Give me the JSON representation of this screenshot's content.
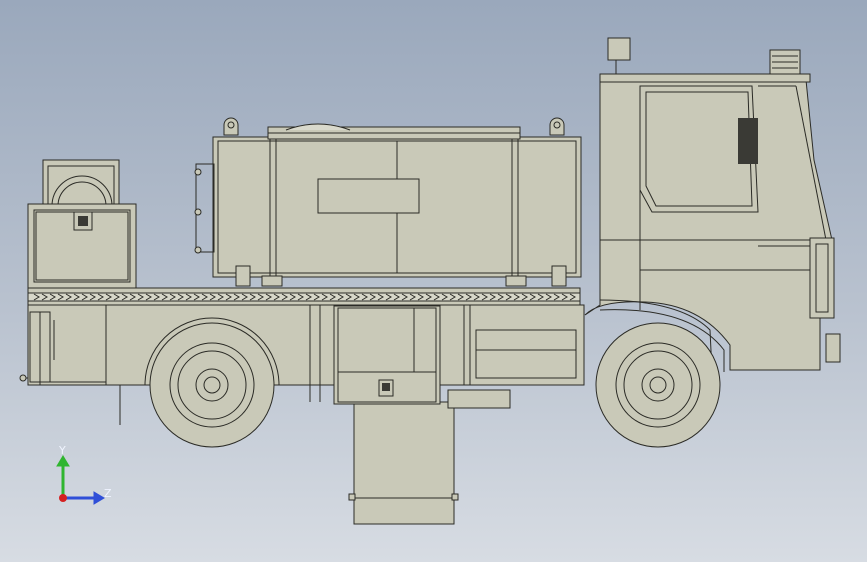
{
  "view": {
    "background_top": "#9aa8bc",
    "background_bottom": "#d7dce3",
    "body_fill": "#c9c9b8",
    "line_color": "#2b2b26"
  },
  "triad": {
    "y_label": "Y",
    "z_label": "Z",
    "y_color": "#2fb52f",
    "z_color": "#2f4fd8",
    "x_color": "#d42020"
  }
}
